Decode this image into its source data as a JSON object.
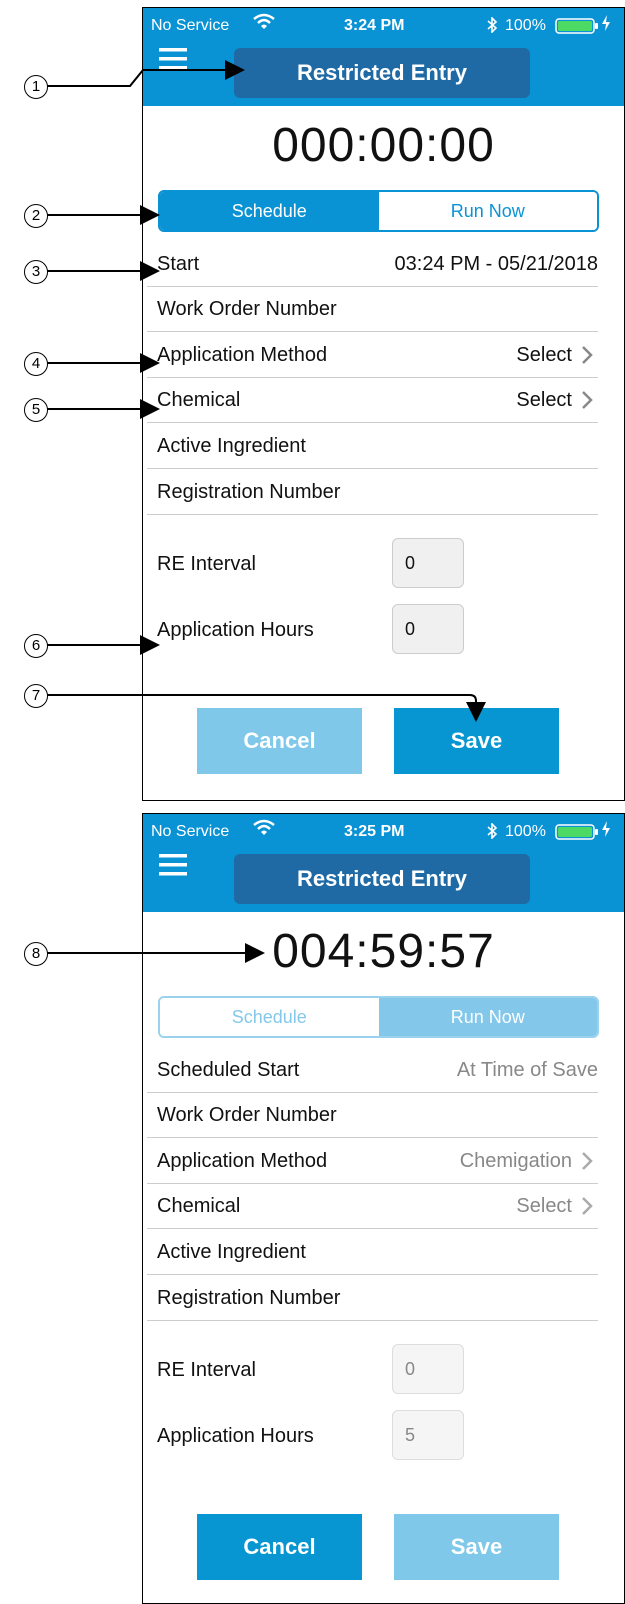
{
  "screens": [
    {
      "status": {
        "carrier": "No Service",
        "time": "3:24 PM",
        "battery": "100%"
      },
      "title": "Restricted Entry",
      "timer": "000:00:00",
      "segment": {
        "schedule": "Schedule",
        "run_now": "Run Now",
        "selected": "schedule"
      },
      "rows": [
        {
          "label": "Start",
          "value": "03:24 PM - 05/21/2018"
        },
        {
          "label": "Work Order Number",
          "value": ""
        },
        {
          "label": "Application Method",
          "value": "Select"
        },
        {
          "label": "Chemical",
          "value": "Select"
        },
        {
          "label": "Active Ingredient",
          "value": ""
        },
        {
          "label": "Registration Number",
          "value": ""
        }
      ],
      "re_interval": {
        "label": "RE Interval",
        "value": "0"
      },
      "application_hours": {
        "label": "Application Hours",
        "value": "0"
      },
      "buttons": {
        "cancel": "Cancel",
        "save": "Save"
      }
    },
    {
      "status": {
        "carrier": "No Service",
        "time": "3:25 PM",
        "battery": "100%"
      },
      "title": "Restricted Entry",
      "timer": "004:59:57",
      "segment": {
        "schedule": "Schedule",
        "run_now": "Run Now",
        "selected": "run_now"
      },
      "rows": [
        {
          "label": "Scheduled Start",
          "value": "At Time of Save"
        },
        {
          "label": "Work Order Number",
          "value": ""
        },
        {
          "label": "Application Method",
          "value": "Chemigation"
        },
        {
          "label": "Chemical",
          "value": "Select"
        },
        {
          "label": "Active Ingredient",
          "value": ""
        },
        {
          "label": "Registration Number",
          "value": ""
        }
      ],
      "re_interval": {
        "label": "RE Interval",
        "value": "0"
      },
      "application_hours": {
        "label": "Application Hours",
        "value": "5"
      },
      "buttons": {
        "cancel": "Cancel",
        "save": "Save"
      }
    }
  ],
  "callouts": [
    "1",
    "2",
    "3",
    "4",
    "5",
    "6",
    "7",
    "8"
  ],
  "colors": {
    "header": "#0a93d4",
    "title_box": "#1f6aa4",
    "button_active": "#0796d2",
    "button_disabled": "#7fc8ea"
  }
}
